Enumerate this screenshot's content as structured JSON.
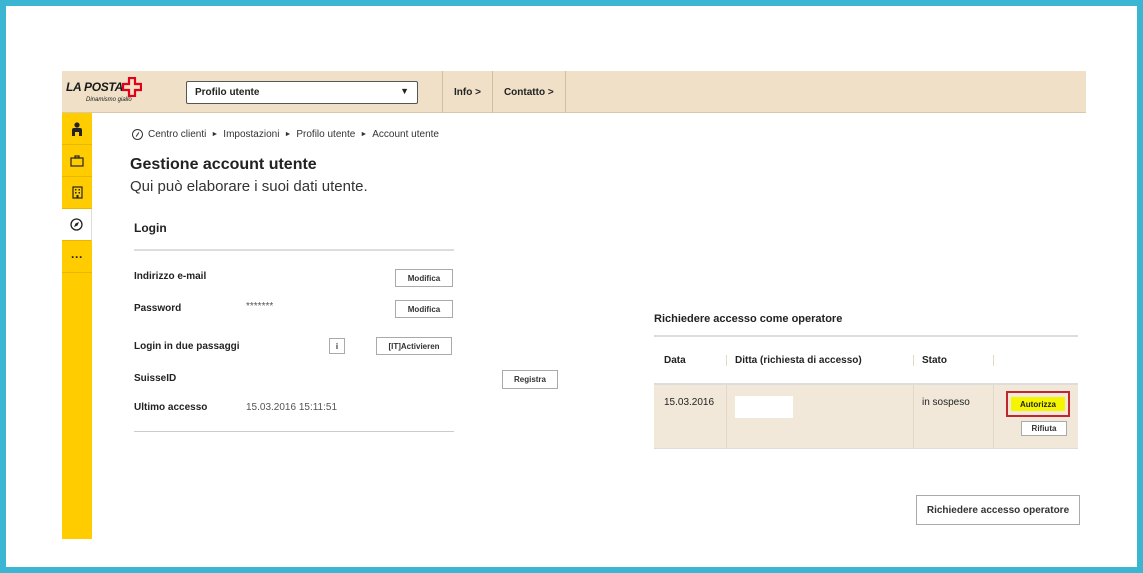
{
  "brand": {
    "name": "LA POSTA",
    "tagline": "Dinamismo giallo",
    "color": "#ffcc00",
    "cross_color": "#e2001a"
  },
  "topbar": {
    "select_value": "Profilo utente",
    "nav": [
      {
        "label": "Info >"
      },
      {
        "label": "Contatto >"
      }
    ]
  },
  "sidebar": {
    "items": [
      {
        "icon": "person-icon",
        "glyph": "♟"
      },
      {
        "icon": "briefcase-icon",
        "glyph": "⛀"
      },
      {
        "icon": "building-icon",
        "glyph": "▦"
      },
      {
        "icon": "compass-icon",
        "glyph": "⊘"
      },
      {
        "icon": "more-icon",
        "glyph": "···"
      }
    ]
  },
  "breadcrumb": [
    "Centro clienti",
    "Impostazioni",
    "Profilo utente",
    "Account utente"
  ],
  "page": {
    "title": "Gestione account utente",
    "subtitle": "Qui può elaborare i suoi dati utente."
  },
  "login": {
    "title": "Login",
    "email_label": "Indirizzo e-mail",
    "email_button": "Modifica",
    "password_label": "Password",
    "password_value": "*******",
    "password_button": "Modifica",
    "twostep_label": "Login in due passaggi",
    "twostep_info": "i",
    "twostep_button": "[IT]Activieren",
    "suisseid_label": "SuisseID",
    "suisseid_button": "Registra",
    "last_access_label": "Ultimo accesso",
    "last_access_value": "15.03.2016 15:11:51"
  },
  "operator": {
    "title": "Richiedere accesso come operatore",
    "columns": [
      "Data",
      "Ditta (richiesta di accesso)",
      "Stato"
    ],
    "row": {
      "date": "15.03.2016",
      "status": "in sospeso",
      "approve": "Autorizza",
      "reject": "Rifiuta"
    },
    "request_button": "Richiedere accesso operatore"
  }
}
